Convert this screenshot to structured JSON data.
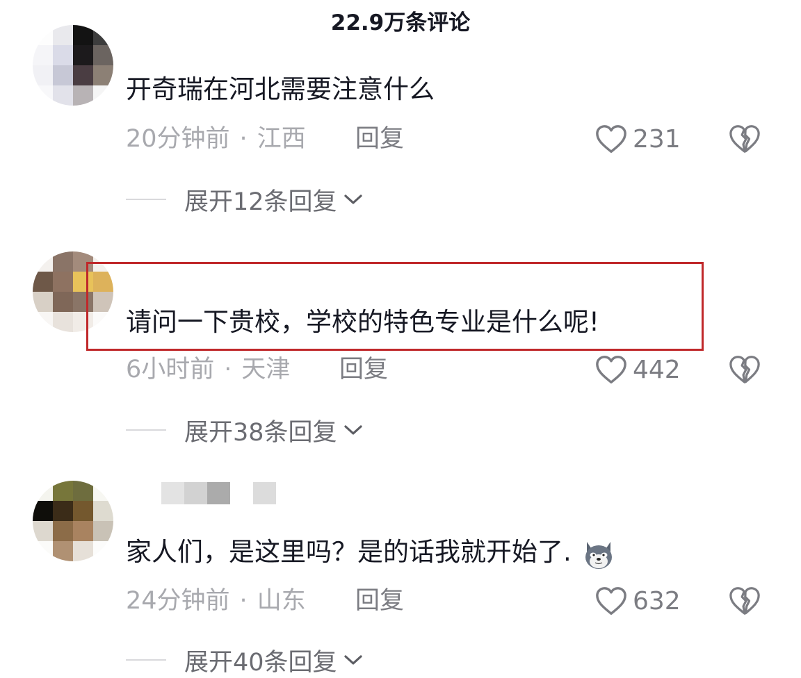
{
  "header": {
    "title": "22.9万条评论"
  },
  "comments": [
    {
      "text": "开奇瑞在河北需要注意什么",
      "time": "20分钟前",
      "location": "江西",
      "reply_label": "回复",
      "likes": "231",
      "expand_label": "展开12条回复"
    },
    {
      "text": "请问一下贵校，学校的特色专业是什么呢!",
      "time": "6小时前",
      "location": "天津",
      "reply_label": "回复",
      "likes": "442",
      "expand_label": "展开38条回复"
    },
    {
      "text": "家人们，是这里吗？是的话我就开始了.",
      "time": "24分钟前",
      "location": "山东",
      "reply_label": "回复",
      "likes": "632",
      "expand_label": "展开40条回复"
    }
  ],
  "meta_separator": "·",
  "icons": {
    "like": "heart-outline-icon",
    "dislike": "broken-heart-icon",
    "expand": "chevron-down-icon",
    "emoji": "husky-dog-emoji"
  },
  "colors": {
    "text": "#161823",
    "meta": "#a8a9ae",
    "highlight": "#c0282a"
  }
}
